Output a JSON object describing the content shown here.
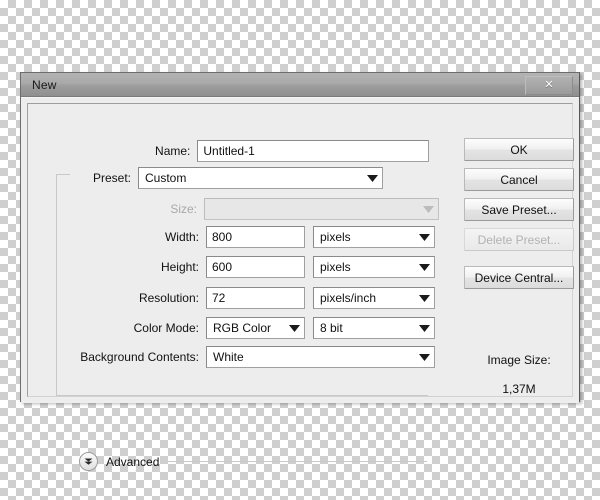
{
  "window": {
    "title": "New",
    "close_icon": "close-icon",
    "close_glyph": "✕"
  },
  "form": {
    "name": {
      "label": "Name:",
      "value": "Untitled-1"
    },
    "preset": {
      "label": "Preset:",
      "value": "Custom"
    },
    "size": {
      "label": "Size:",
      "value": "",
      "disabled": true
    },
    "width": {
      "label": "Width:",
      "value": "800",
      "unit": "pixels"
    },
    "height": {
      "label": "Height:",
      "value": "600",
      "unit": "pixels"
    },
    "resolution": {
      "label": "Resolution:",
      "value": "72",
      "unit": "pixels/inch"
    },
    "color_mode": {
      "label": "Color Mode:",
      "value": "RGB Color",
      "depth": "8 bit"
    },
    "background_contents": {
      "label": "Background Contents:",
      "value": "White"
    },
    "advanced": {
      "label": "Advanced",
      "icon": "chevron-down-circle-icon"
    }
  },
  "buttons": {
    "ok": "OK",
    "cancel": "Cancel",
    "save_preset": "Save Preset...",
    "delete_preset": "Delete Preset...",
    "device_central": "Device Central..."
  },
  "image_size": {
    "title": "Image Size:",
    "value": "1,37M"
  },
  "colors": {
    "dialog_background": "#ededed",
    "titlebar_top": "#b4b4b4",
    "titlebar_bottom": "#8f8f8f",
    "field_background": "#ffffff",
    "disabled_text": "#b0b0b0",
    "checker_light": "#ffffff",
    "checker_dark": "#cfcfcf"
  }
}
